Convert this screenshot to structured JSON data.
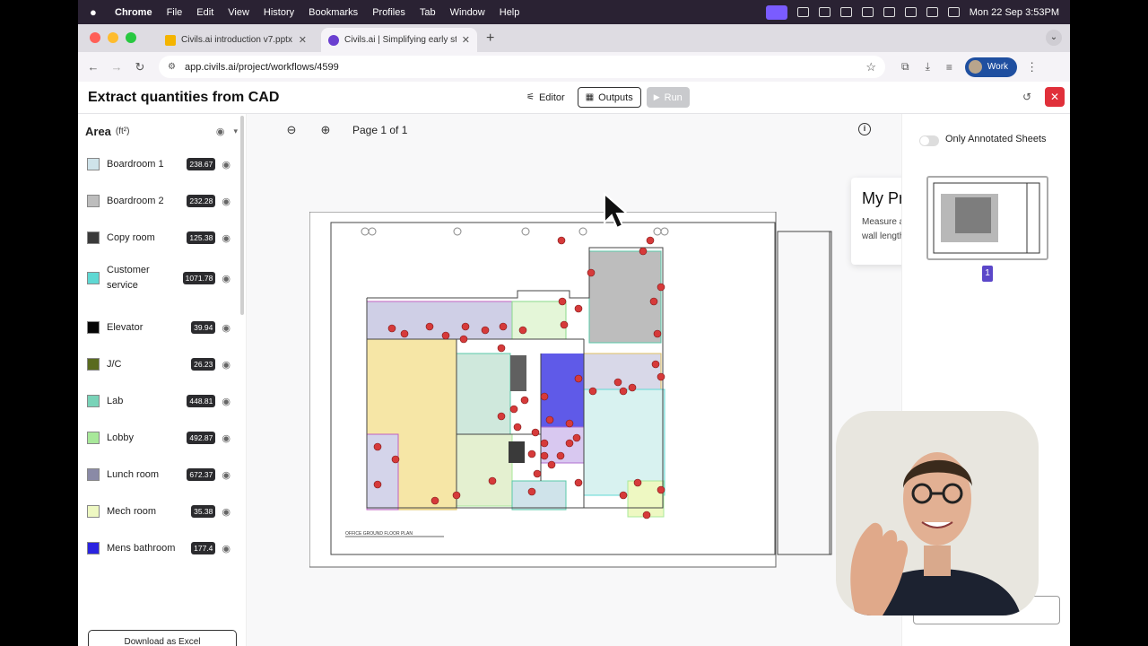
{
  "menubar": {
    "items": [
      "Chrome",
      "File",
      "Edit",
      "View",
      "History",
      "Bookmarks",
      "Profiles",
      "Tab",
      "Window",
      "Help"
    ],
    "clock": "Mon 22 Sep  3:53PM"
  },
  "tabs": [
    {
      "title": "Civils.ai introduction v7.pptx",
      "favicon_color": "#f4b400"
    },
    {
      "title": "Civils.ai | Simplifying early st",
      "favicon_color": "#6a3fd0"
    }
  ],
  "browser": {
    "url": "app.civils.ai/project/workflows/4599",
    "profile": "Work"
  },
  "app": {
    "title": "Extract quantities from CAD",
    "editor_label": "Editor",
    "outputs_label": "Outputs",
    "run_label": "Run"
  },
  "area_panel": {
    "title": "Area",
    "unit": "(ft²)",
    "items": [
      {
        "name": "Boardroom 1",
        "value": "238.67",
        "color": "#cfe3ea"
      },
      {
        "name": "Boardroom 2",
        "value": "232.28",
        "color": "#bdbdbd"
      },
      {
        "name": "Copy room",
        "value": "125.38",
        "color": "#3a3a3a"
      },
      {
        "name": "Customer service",
        "value": "1071.78",
        "color": "#5fd8d3"
      },
      {
        "name": "Elevator",
        "value": "39.94",
        "color": "#050505"
      },
      {
        "name": "J/C",
        "value": "26.23",
        "color": "#5a6b1f"
      },
      {
        "name": "Lab",
        "value": "448.81",
        "color": "#79d3b8"
      },
      {
        "name": "Lobby",
        "value": "492.87",
        "color": "#a8e89a"
      },
      {
        "name": "Lunch room",
        "value": "672.37",
        "color": "#8a8aa6"
      },
      {
        "name": "Mech room",
        "value": "35.38",
        "color": "#eef8c2"
      },
      {
        "name": "Mens bathroom",
        "value": "177.4",
        "color": "#2a23e0"
      }
    ],
    "download_label": "Download as Excel"
  },
  "viewer": {
    "page_label": "Page 1 of 1",
    "plan_caption": "OFFICE GROUND FLOOR PLAN"
  },
  "prompt": {
    "title": "My Prompt",
    "text": "Measure and categorise floor areas and wall lengths. Count doors, toilets, sinks."
  },
  "sheets": {
    "toggle_label": "Only Annotated Sheets",
    "page_number": "1"
  }
}
